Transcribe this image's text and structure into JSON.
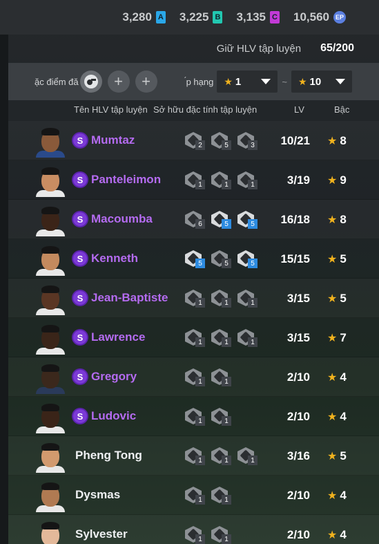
{
  "currencies": [
    {
      "value": "3,280",
      "code": "A",
      "color": "#2aa7e8"
    },
    {
      "value": "3,225",
      "code": "B",
      "color": "#22c7b0"
    },
    {
      "value": "3,135",
      "code": "C",
      "color": "#c23ad6"
    },
    {
      "value": "10,560",
      "code": "EP",
      "color": "#5b7fe0"
    }
  ],
  "capacity": {
    "label": "Giữ HLV tập luyện",
    "value": "65/200"
  },
  "filters": {
    "trait_label": "ặc điểm đă",
    "rank_label": "́p hạng",
    "min_grade": "1",
    "separator": "~",
    "max_grade": "10"
  },
  "columns": {
    "name": "Tên HLV tập luyện",
    "traits": "Sở hữu đặc tính tập luyện",
    "lv": "LV",
    "grade": "Bậc"
  },
  "coaches": [
    {
      "name": "Mumtaz",
      "special": true,
      "lv": "10/21",
      "grade": "8",
      "skin": "#8a5a3a",
      "shirt": "#2a4a8a",
      "traits": [
        {
          "lvl": "2",
          "blue": false
        },
        {
          "lvl": "5",
          "blue": false
        },
        {
          "lvl": "3",
          "blue": false
        }
      ]
    },
    {
      "name": "Panteleimon",
      "special": true,
      "lv": "3/19",
      "grade": "9",
      "skin": "#c98d62",
      "shirt": "#e8e8e8",
      "traits": [
        {
          "lvl": "1",
          "blue": false
        },
        {
          "lvl": "1",
          "blue": false
        },
        {
          "lvl": "1",
          "blue": false
        }
      ]
    },
    {
      "name": "Macoumba",
      "special": true,
      "lv": "16/18",
      "grade": "8",
      "skin": "#3b2418",
      "shirt": "#e8e8e8",
      "traits": [
        {
          "lvl": "6",
          "blue": false
        },
        {
          "lvl": "5",
          "blue": true
        },
        {
          "lvl": "5",
          "blue": true
        }
      ]
    },
    {
      "name": "Kenneth",
      "special": true,
      "lv": "15/15",
      "grade": "5",
      "skin": "#c48a5e",
      "shirt": "#e8e8e8",
      "traits": [
        {
          "lvl": "5",
          "blue": true
        },
        {
          "lvl": "5",
          "blue": false
        },
        {
          "lvl": "5",
          "blue": true
        }
      ]
    },
    {
      "name": "Jean-Baptiste",
      "special": true,
      "lv": "3/15",
      "grade": "5",
      "skin": "#5a3624",
      "shirt": "#e8e8e8",
      "traits": [
        {
          "lvl": "1",
          "blue": false
        },
        {
          "lvl": "1",
          "blue": false
        },
        {
          "lvl": "1",
          "blue": false
        }
      ]
    },
    {
      "name": "Lawrence",
      "special": true,
      "lv": "3/15",
      "grade": "7",
      "skin": "#3a2519",
      "shirt": "#e8e8e8",
      "traits": [
        {
          "lvl": "1",
          "blue": false
        },
        {
          "lvl": "1",
          "blue": false
        },
        {
          "lvl": "1",
          "blue": false
        }
      ]
    },
    {
      "name": "Gregory",
      "special": true,
      "lv": "2/10",
      "grade": "4",
      "skin": "#3b281c",
      "shirt": "#2a3a5a",
      "traits": [
        {
          "lvl": "1",
          "blue": false
        },
        {
          "lvl": "1",
          "blue": false
        }
      ]
    },
    {
      "name": "Ludovic",
      "special": true,
      "lv": "2/10",
      "grade": "4",
      "skin": "#3a2418",
      "shirt": "#e8e8e8",
      "traits": [
        {
          "lvl": "1",
          "blue": false
        },
        {
          "lvl": "1",
          "blue": false
        }
      ]
    },
    {
      "name": "Pheng Tong",
      "special": false,
      "lv": "3/16",
      "grade": "5",
      "skin": "#d29a6e",
      "shirt": "#e8e8e8",
      "traits": [
        {
          "lvl": "1",
          "blue": false
        },
        {
          "lvl": "1",
          "blue": false
        },
        {
          "lvl": "1",
          "blue": false
        }
      ]
    },
    {
      "name": "Dysmas",
      "special": false,
      "lv": "2/10",
      "grade": "4",
      "skin": "#b07a52",
      "shirt": "#e8e8e8",
      "traits": [
        {
          "lvl": "1",
          "blue": false
        },
        {
          "lvl": "1",
          "blue": false
        }
      ]
    },
    {
      "name": "Sylvester",
      "special": false,
      "lv": "2/10",
      "grade": "4",
      "skin": "#e3b99a",
      "shirt": "#e8e8e8",
      "traits": [
        {
          "lvl": "1",
          "blue": false
        },
        {
          "lvl": "1",
          "blue": false
        }
      ]
    }
  ]
}
